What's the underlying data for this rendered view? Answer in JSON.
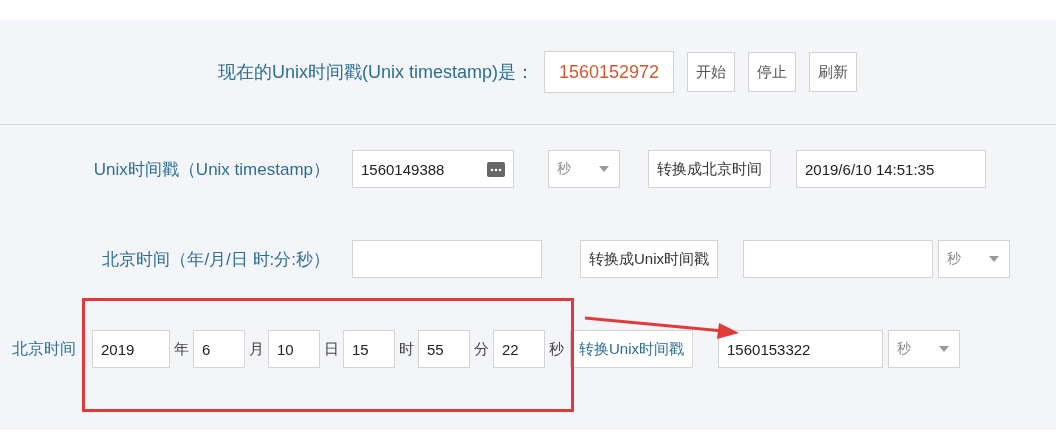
{
  "current": {
    "label": "现在的Unix时间戳(Unix timestamp)是：",
    "value": "1560152972",
    "buttons": [
      "开始",
      "停止",
      "刷新"
    ]
  },
  "rows": [
    {
      "kind": "timestamp",
      "label": "Unix时间戳（Unix timestamp）",
      "input": "1560149388",
      "unit": "秒",
      "button": "转换成北京时间",
      "result": "2019/6/10 14:51:35"
    },
    {
      "kind": "datetime",
      "label": "北京时间（年/月/日 时:分:秒）",
      "button": "转换成Unix时间戳",
      "result_unit": "秒"
    },
    {
      "kind": "parts",
      "label": "北京时间",
      "parts": [
        {
          "value": "2019",
          "unit": "年"
        },
        {
          "value": "6",
          "unit": "月"
        },
        {
          "value": "10",
          "unit": "日"
        },
        {
          "value": "15",
          "unit": "时"
        },
        {
          "value": "55",
          "unit": "分"
        },
        {
          "value": "22",
          "unit": "秒"
        }
      ],
      "button": "转换Unix时间戳",
      "result": "1560153322",
      "result_unit": "秒"
    }
  ]
}
